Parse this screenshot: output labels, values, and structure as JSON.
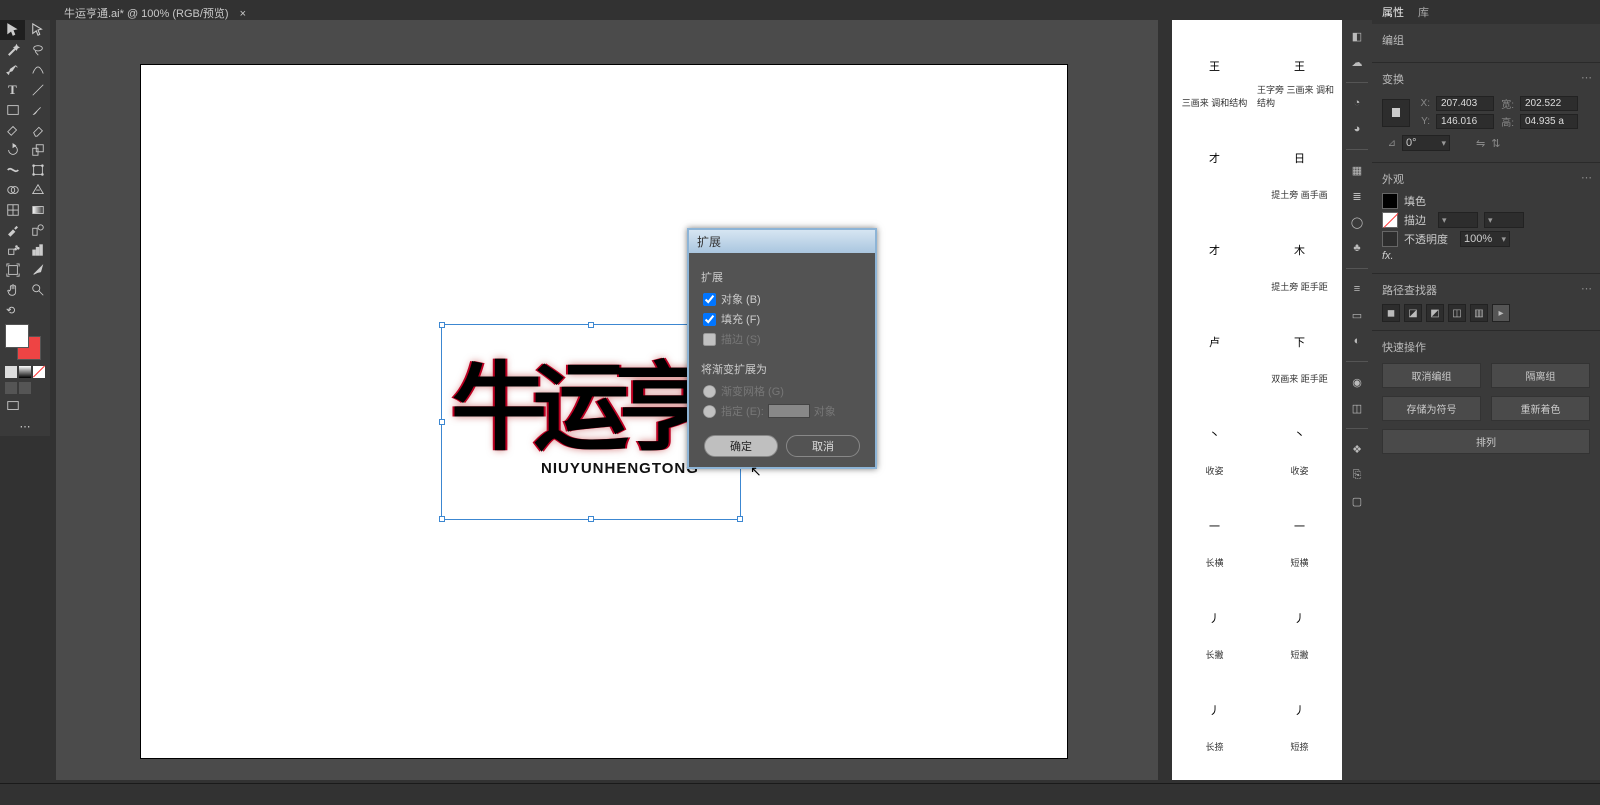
{
  "tab": {
    "title": "牛运亨通.ai* @ 100% (RGB/预览)",
    "close": "×"
  },
  "artwork": {
    "text": "牛运亨",
    "sub": "NIUYUNHENGTONG"
  },
  "dialog": {
    "title": "扩展",
    "section1": "扩展",
    "opt_object": "对象 (B)",
    "opt_fill": "填充 (F)",
    "opt_stroke": "描边 (S)",
    "section2": "将渐变扩展为",
    "grad_mesh": "渐变网格 (G)",
    "grad_spec_pre": "指定 (E):",
    "grad_spec_post": "对象",
    "ok": "确定",
    "cancel": "取消"
  },
  "brushes": [
    {
      "g": "王",
      "l": "三画来\n调和结构"
    },
    {
      "g": "王",
      "l": "王字旁\n三画来\n调和结构"
    },
    {
      "g": "才",
      "l": ""
    },
    {
      "g": "日",
      "l": "提土旁\n画手画"
    },
    {
      "g": "才",
      "l": ""
    },
    {
      "g": "木",
      "l": "提土旁\n距手距"
    },
    {
      "g": "卢",
      "l": ""
    },
    {
      "g": "下",
      "l": "双画来\n距手距"
    },
    {
      "g": "丶",
      "l": "收姿"
    },
    {
      "g": "丶",
      "l": "收姿"
    },
    {
      "g": "一",
      "l": "长横"
    },
    {
      "g": "一",
      "l": "短横"
    },
    {
      "g": "丿",
      "l": "长撇"
    },
    {
      "g": "丿",
      "l": "短撇"
    },
    {
      "g": "丿",
      "l": "长捺"
    },
    {
      "g": "丿",
      "l": "短捺"
    }
  ],
  "props": {
    "tab_properties": "属性",
    "tab_style": "库",
    "group": "编组",
    "transform": "变换",
    "x": "207.403",
    "y": "146.016",
    "w": "202.522",
    "h": "04.935 a",
    "angle": "0°",
    "appearance": "外观",
    "fill": "填色",
    "stroke": "描边",
    "opacity_label": "不透明度",
    "opacity": "100%",
    "fx": "fx.",
    "align": "路径查找器",
    "quick": "快速操作",
    "btn_ungroup": "取消编组",
    "btn_isolate": "隔离组",
    "btn_savesym": "存储为符号",
    "btn_recolor": "重新着色",
    "btn_arrange": "排列",
    "xl": "X:",
    "yl": "Y:",
    "wl": "宽:",
    "hl": "高:"
  }
}
